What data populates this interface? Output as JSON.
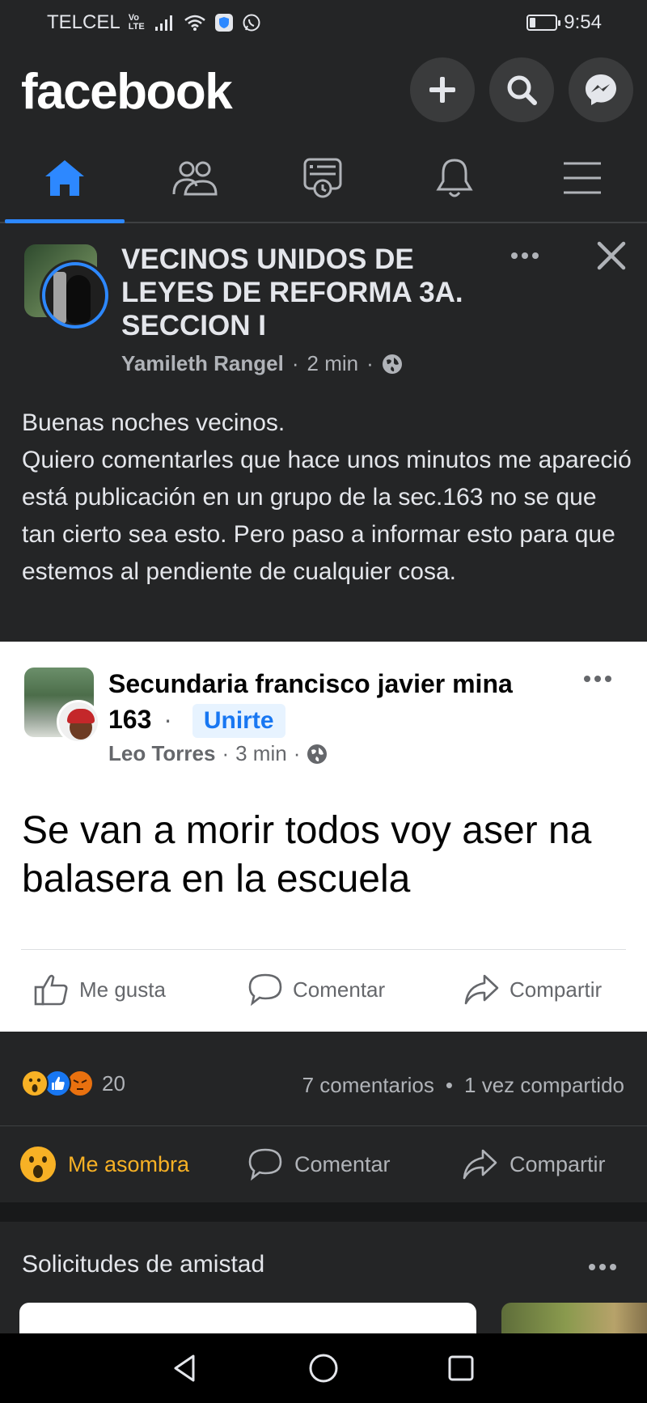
{
  "status_bar": {
    "carrier": "TELCEL",
    "network_badge": "Vo LTE",
    "time": "9:54",
    "icons": [
      "signal-icon",
      "wifi-icon",
      "shield-icon",
      "whatsapp-icon",
      "battery-icon"
    ],
    "battery_level_fraction": 0.2
  },
  "header": {
    "logo": "facebook",
    "buttons": [
      "plus-icon",
      "search-icon",
      "messenger-icon"
    ]
  },
  "nav_tabs": [
    {
      "name": "home",
      "icon": "home-icon",
      "active": true
    },
    {
      "name": "friends",
      "icon": "friends-icon",
      "active": false
    },
    {
      "name": "feeds",
      "icon": "feeds-icon",
      "active": false
    },
    {
      "name": "notifications",
      "icon": "bell-icon",
      "active": false
    },
    {
      "name": "menu",
      "icon": "hamburger-icon",
      "active": false
    }
  ],
  "post": {
    "group_name": "VECINOS UNIDOS DE LEYES DE REFORMA 3A. SECCION I",
    "author": "Yamileth Rangel",
    "separator": "·",
    "time": "2 min",
    "text_lines": [
      "Buenas noches vecinos.",
      "Quiero comentarles que hace unos minutos me apareció está publicación en un grupo de la sec.163 no se que tan cierto sea esto. Pero paso a informar esto para que estemos al pendiente de cualquier cosa."
    ]
  },
  "shared_post": {
    "group_name": "Secundaria francisco javier mina 163",
    "separator": "·",
    "join_label": "Unirte",
    "author": "Leo Torres",
    "time": "3 min",
    "text": "Se van a morir todos voy aser na balasera en la escuela",
    "actions": {
      "like": "Me gusta",
      "comment": "Comentar",
      "share": "Compartir"
    }
  },
  "stats": {
    "reaction_count": "20",
    "comments": "7 comentarios",
    "bullet": "•",
    "shares": "1 vez compartido"
  },
  "actions": {
    "react": "Me asombra",
    "comment": "Comentar",
    "share": "Compartir"
  },
  "friend_requests": {
    "title": "Solicitudes de amistad"
  },
  "colors": {
    "background": "#242526",
    "accent": "#2d88ff",
    "wow": "#f7b125"
  }
}
